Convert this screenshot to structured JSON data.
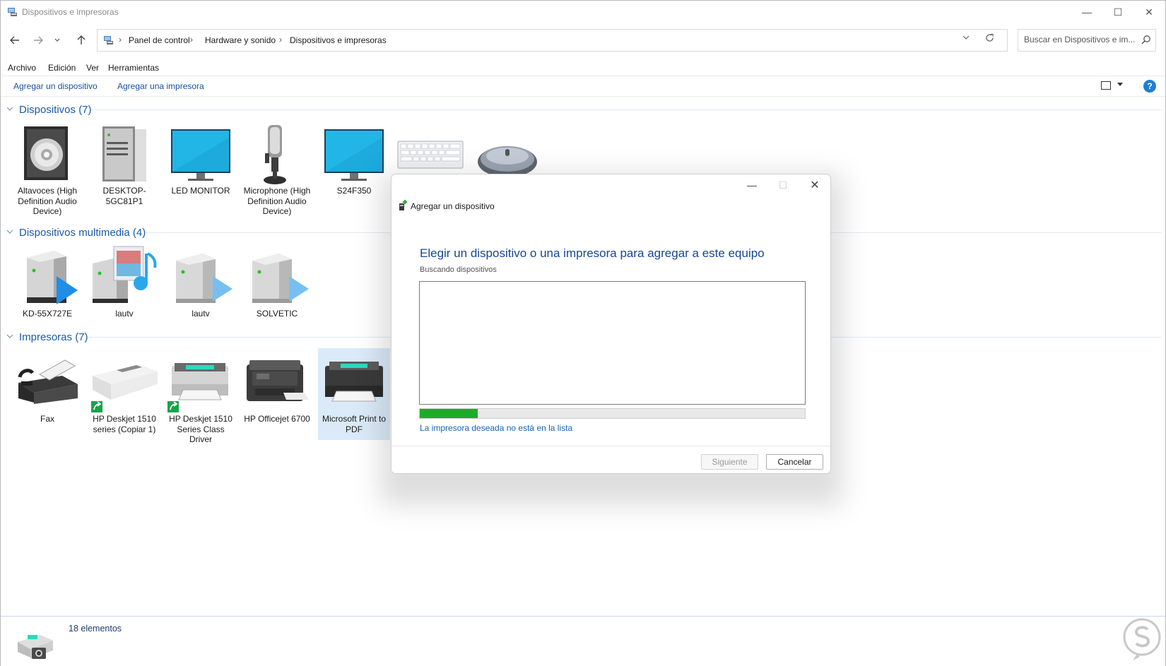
{
  "window": {
    "title": "Dispositivos e impresoras",
    "controls": {
      "minimize": "—",
      "maximize": "☐",
      "close": "✕"
    }
  },
  "address": {
    "crumbs": [
      "Panel de control",
      "Hardware y sonido",
      "Dispositivos e impresoras"
    ],
    "separator": "›"
  },
  "search": {
    "placeholder": "Buscar en Dispositivos e im..."
  },
  "menu": [
    "Archivo",
    "Edición",
    "Ver",
    "Herramientas"
  ],
  "commands": {
    "add_device": "Agregar un dispositivo",
    "add_printer": "Agregar una impresora",
    "help": "?"
  },
  "groups": {
    "devices": {
      "title": "Dispositivos (7)",
      "items": [
        {
          "label": "Altavoces (High Definition Audio Device)",
          "icon": "speaker-icon"
        },
        {
          "label": "DESKTOP-5GC81P1",
          "icon": "computer-tower-icon"
        },
        {
          "label": "LED MONITOR",
          "icon": "monitor-icon"
        },
        {
          "label": "Microphone (High Definition Audio Device)",
          "icon": "microphone-icon"
        },
        {
          "label": "S24F350",
          "icon": "monitor-icon"
        },
        {
          "label": "",
          "icon": "keyboard-icon"
        },
        {
          "label": "",
          "icon": "mouse-icon"
        }
      ]
    },
    "multimedia": {
      "title": "Dispositivos multimedia (4)",
      "items": [
        {
          "label": "KD-55X727E",
          "icon": "media-server-icon"
        },
        {
          "label": "lautv",
          "icon": "media-library-icon"
        },
        {
          "label": "lautv",
          "icon": "media-server-icon"
        },
        {
          "label": "SOLVETIC",
          "icon": "media-server-icon"
        }
      ]
    },
    "printers": {
      "title": "Impresoras (7)",
      "items": [
        {
          "label": "Fax",
          "icon": "fax-icon"
        },
        {
          "label": "HP Deskjet 1510 series (Copiar 1)",
          "icon": "printer-icon"
        },
        {
          "label": "HP Deskjet 1510 Series Class Driver",
          "icon": "printer-icon"
        },
        {
          "label": "HP Officejet 6700",
          "icon": "multifunction-printer-icon"
        },
        {
          "label": "Microsoft Print to PDF",
          "icon": "printer-icon"
        }
      ]
    }
  },
  "status": {
    "count_text": "18 elementos"
  },
  "dialog": {
    "title": "Agregar un dispositivo",
    "heading": "Elegir un dispositivo o una impresora para agregar a este equipo",
    "searching": "Buscando dispositivos",
    "progress": 0.15,
    "link": "La impresora deseada no está en la lista",
    "next": "Siguiente",
    "cancel": "Cancelar",
    "controls": {
      "minimize": "—",
      "maximize": "☐",
      "close": "✕"
    }
  },
  "colors": {
    "accent": "#1a5aa6",
    "progress": "#1faa2a",
    "link": "#1562b8",
    "selection": "#dbeaf8"
  }
}
